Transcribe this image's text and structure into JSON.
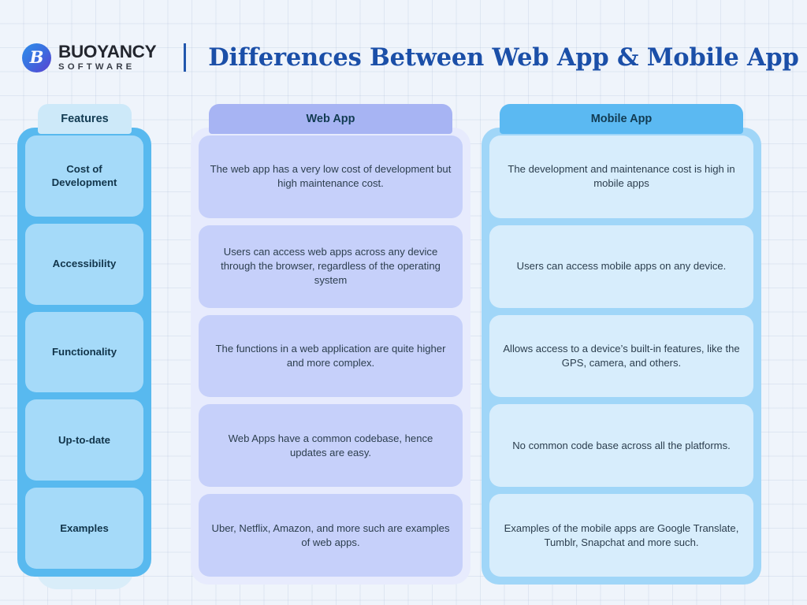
{
  "brand": {
    "logo_icon": "buoyancy-b-logo-icon",
    "logo_glyph": "B",
    "name": "BUOYANCY",
    "tagline": "SOFTWARE"
  },
  "header": {
    "divider": "vertical-divider",
    "title": "Differences Between Web App & Mobile App"
  },
  "colors": {
    "background": "#eff4fb",
    "title_blue": "#1b4fa8",
    "features_frame": "#58b9ef",
    "features_cell": "#a5daf9",
    "features_header": "#cde9f9",
    "web_header": "#a7b4f3",
    "web_frame": "#e7ebfd",
    "web_cell": "#c6d0fa",
    "mobile_header": "#5bb9f2",
    "mobile_frame": "#a0d6f8",
    "mobile_cell": "#d7edfc",
    "body_text": "#2c3e4e"
  },
  "table": {
    "columns": [
      {
        "key": "features",
        "header": "Features"
      },
      {
        "key": "web",
        "header": "Web App"
      },
      {
        "key": "mobile",
        "header": "Mobile App"
      }
    ],
    "rows": [
      {
        "feature": "Cost of Development",
        "web": "The web app has a very low cost of development but high maintenance cost.",
        "mobile": "The development and maintenance cost is high in mobile apps"
      },
      {
        "feature": "Accessibility",
        "web": "Users can access web apps across any device through the browser, regardless of the operating system",
        "mobile": "Users can access mobile apps on any device."
      },
      {
        "feature": "Functionality",
        "web": "The functions in a web application are quite higher and more complex.",
        "mobile": "Allows access to a device’s built-in features, like the GPS, camera, and others."
      },
      {
        "feature": "Up-to-date",
        "web": "Web Apps have a common codebase, hence updates are easy.",
        "mobile": "No common code base across all the platforms."
      },
      {
        "feature": "Examples",
        "web": "Uber, Netflix, Amazon, and more such are examples of web apps.",
        "mobile": "Examples of the mobile apps are Google Translate, Tumblr, Snapchat and more such."
      }
    ]
  }
}
